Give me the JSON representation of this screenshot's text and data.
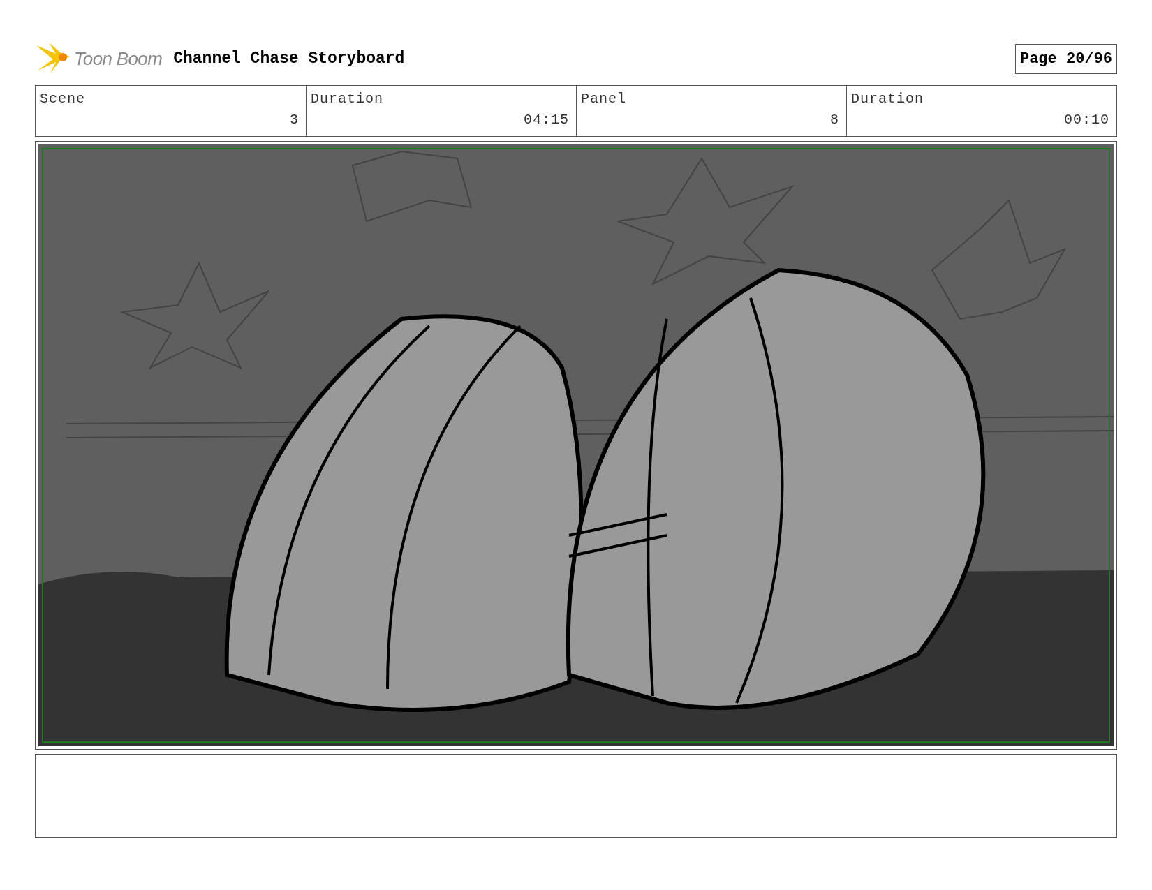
{
  "header": {
    "logo_text": "Toon Boom",
    "title": "Channel Chase Storyboard",
    "page": "Page 20/96"
  },
  "fields": [
    {
      "label": "Scene",
      "value": "3"
    },
    {
      "label": "Duration",
      "value": "04:15"
    },
    {
      "label": "Panel",
      "value": "8"
    },
    {
      "label": "Duration",
      "value": "00:10"
    }
  ]
}
